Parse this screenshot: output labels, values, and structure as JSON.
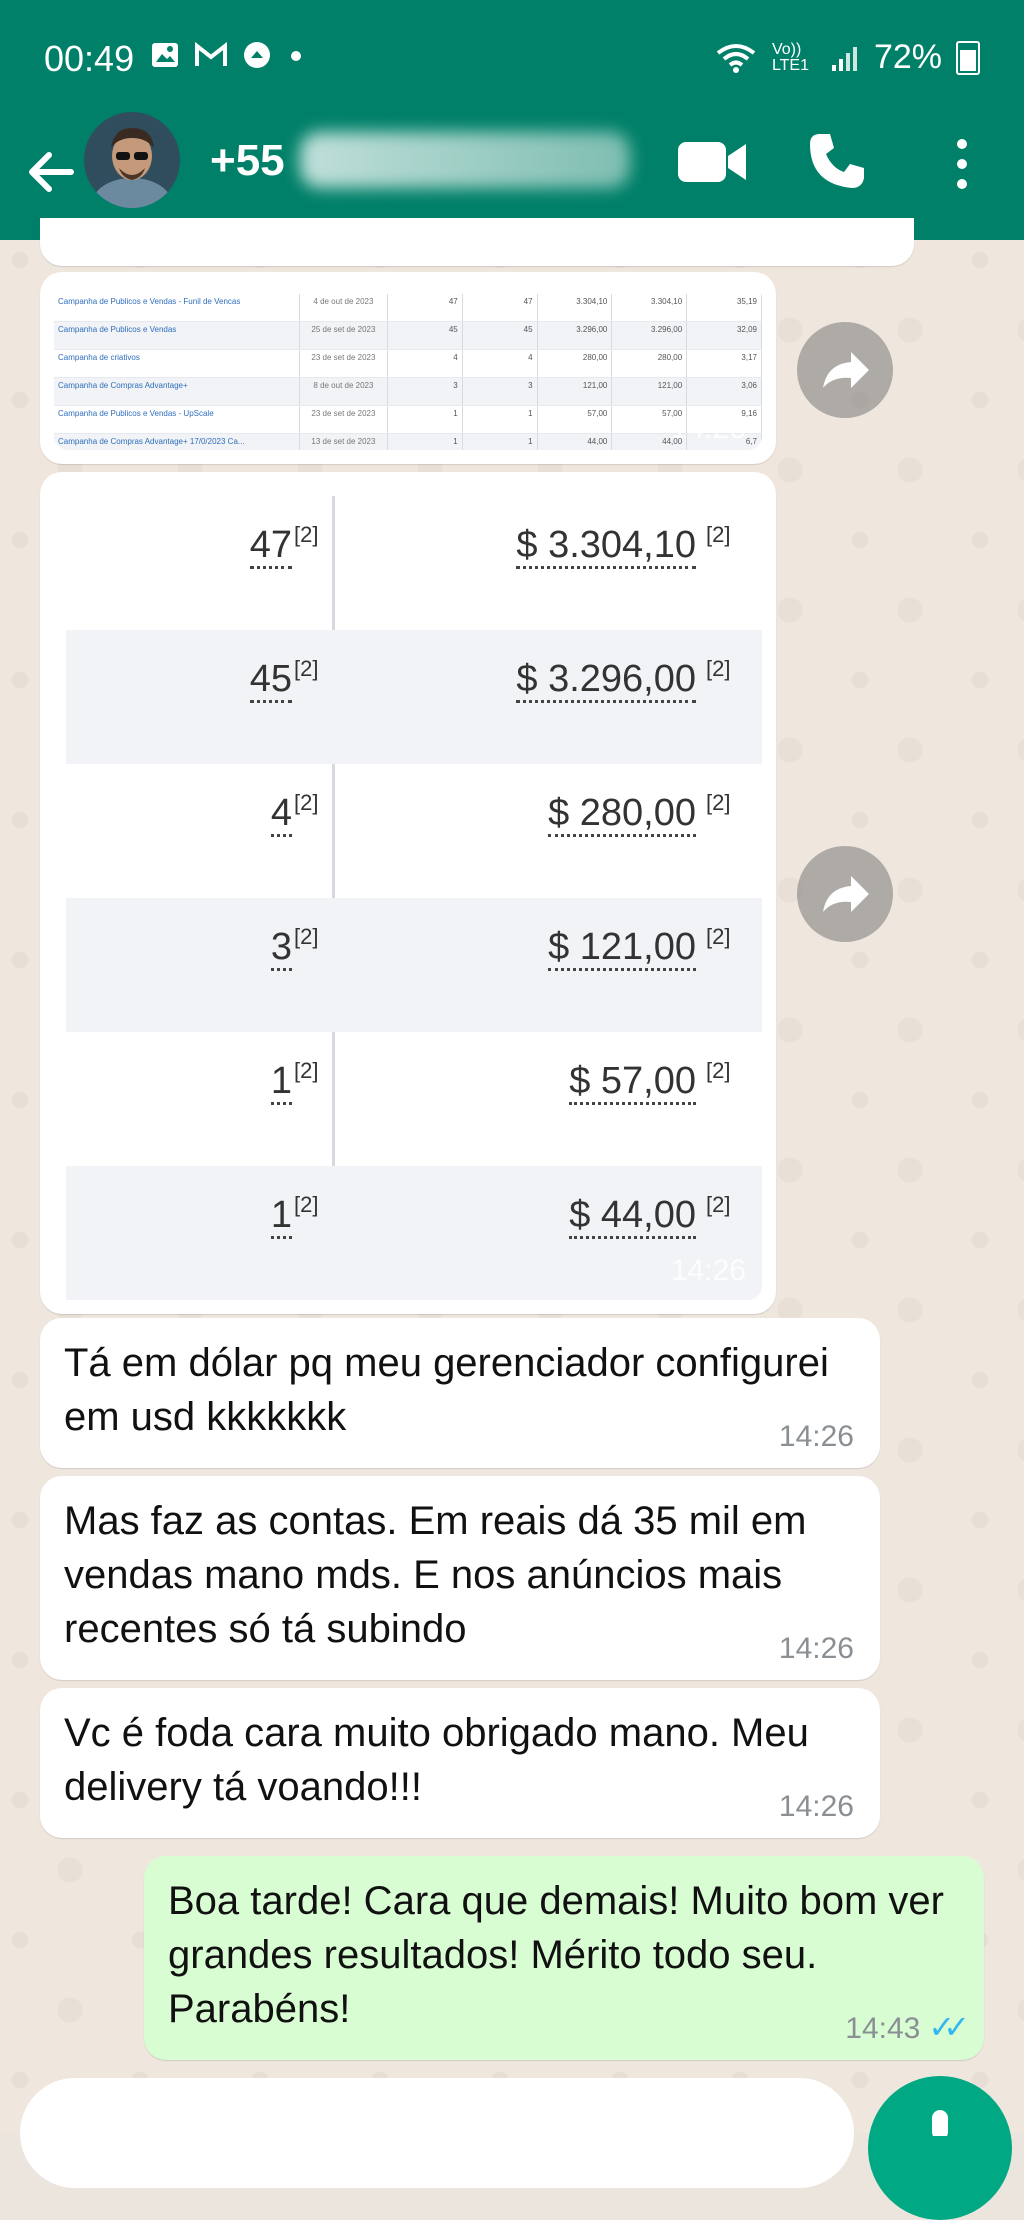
{
  "status_bar": {
    "time": "00:49",
    "network": "Vo)) LTE1",
    "battery": "72%"
  },
  "header": {
    "contact": "+55",
    "accent_color": "#008069"
  },
  "messages": {
    "sheet_preview": {
      "time": "14:26",
      "rows": [
        {
          "name": "Campanha de Publicos e Vendas - Funil de Vencas",
          "date": "4 de out de 2023",
          "a": "47",
          "b": "47",
          "c": "3.304,10",
          "d": "3.304,10",
          "e": "35,19"
        },
        {
          "name": "Campanha de Publicos e Vendas",
          "date": "25 de set de 2023",
          "a": "45",
          "b": "45",
          "c": "3.296,00",
          "d": "3.296,00",
          "e": "32,09"
        },
        {
          "name": "Campanha de criativos",
          "date": "23 de set de 2023",
          "a": "4",
          "b": "4",
          "c": "280,00",
          "d": "280,00",
          "e": "3,17"
        },
        {
          "name": "Campanha de Compras Advantage+",
          "date": "8 de out de 2023",
          "a": "3",
          "b": "3",
          "c": "121,00",
          "d": "121,00",
          "e": "3,06"
        },
        {
          "name": "Campanha de Publicos e Vendas - UpScale",
          "date": "23 de set de 2023",
          "a": "1",
          "b": "1",
          "c": "57,00",
          "d": "57,00",
          "e": "9,16"
        },
        {
          "name": "Campanha de Compras Advantage+ 17/0/2023 Ca...",
          "date": "13 de set de 2023",
          "a": "1",
          "b": "1",
          "c": "44,00",
          "d": "44,00",
          "e": "6,7"
        }
      ]
    },
    "zoom_table": {
      "time": "14:26",
      "footnote": "[2]",
      "rows": [
        {
          "count": "47",
          "amount": "$ 3.304,10"
        },
        {
          "count": "45",
          "amount": "$ 3.296,00"
        },
        {
          "count": "4",
          "amount": "$ 280,00"
        },
        {
          "count": "3",
          "amount": "$ 121,00"
        },
        {
          "count": "1",
          "amount": "$ 57,00"
        },
        {
          "count": "1",
          "amount": "$ 44,00"
        }
      ]
    },
    "msg1": {
      "text": "Tá em dólar pq meu gerenciador configurei em usd kkkkkkk",
      "time": "14:26"
    },
    "msg2": {
      "text": "Mas faz as contas. Em reais dá 35 mil em vendas mano mds. E nos anúncios mais recentes só tá subindo",
      "time": "14:26"
    },
    "msg3": {
      "text": "Vc é foda cara muito obrigado mano. Meu delivery tá voando!!!",
      "time": "14:26"
    },
    "msg4": {
      "text": "Boa tarde! Cara que demais! Muito bom ver grandes resultados! Mérito todo seu. Parabéns!",
      "time": "14:43"
    }
  }
}
